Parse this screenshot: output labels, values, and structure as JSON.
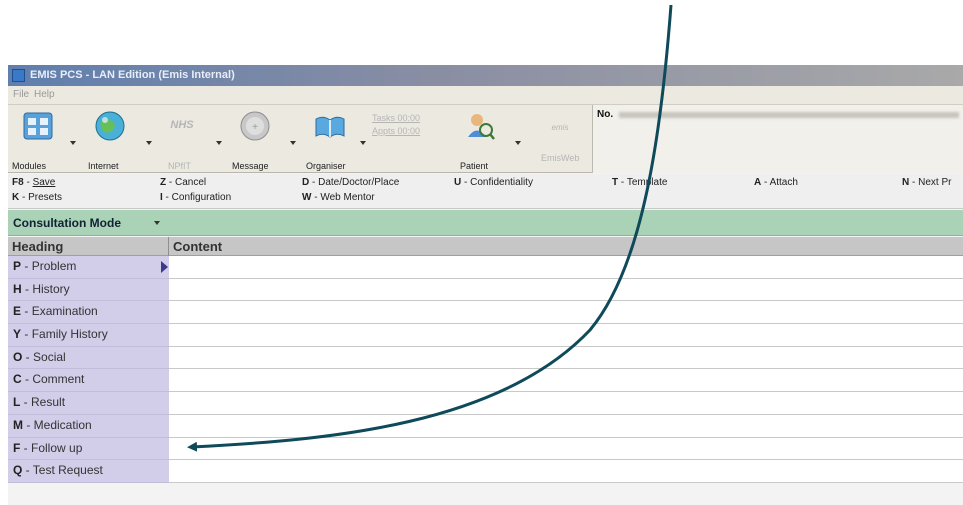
{
  "window": {
    "title": "EMIS PCS - LAN Edition (Emis Internal)"
  },
  "menu": [
    "File",
    "Help"
  ],
  "toolbar": {
    "modules": "Modules",
    "internet": "Internet",
    "nhs_logo": "NHS",
    "nhs_label": "NPfIT",
    "message": "Message",
    "tasks_text": "Tasks 00:00",
    "appts_text": "Appts 00:00",
    "organiser": "Organiser",
    "patient": "Patient",
    "emisweb_logo": "emis",
    "emisweb": "EmisWeb"
  },
  "patient_bar": {
    "no_label": "No."
  },
  "shortcuts": [
    {
      "key": "F8",
      "label": "Save"
    },
    {
      "key": "Z",
      "label": "Cancel"
    },
    {
      "key": "D",
      "label": "Date/Doctor/Place"
    },
    {
      "key": "U",
      "label": "Confidentiality"
    },
    {
      "key": "T",
      "label": "Template"
    },
    {
      "key": "A",
      "label": "Attach"
    },
    {
      "key": "N",
      "label": "Next Pr"
    },
    {
      "key": "K",
      "label": "Presets"
    },
    {
      "key": "I",
      "label": "Configuration"
    },
    {
      "key": "W",
      "label": "Web Mentor"
    }
  ],
  "mode": {
    "label": "Consultation Mode"
  },
  "grid": {
    "heading_col": "Heading",
    "content_col": "Content",
    "rows": [
      {
        "key": "P",
        "label": "Problem"
      },
      {
        "key": "H",
        "label": "History"
      },
      {
        "key": "E",
        "label": "Examination"
      },
      {
        "key": "Y",
        "label": "Family History"
      },
      {
        "key": "O",
        "label": "Social"
      },
      {
        "key": "C",
        "label": "Comment"
      },
      {
        "key": "L",
        "label": "Result"
      },
      {
        "key": "M",
        "label": "Medication"
      },
      {
        "key": "F",
        "label": "Follow up"
      },
      {
        "key": "Q",
        "label": "Test Request"
      }
    ]
  },
  "colors": {
    "annotation_arrow": "#0e4a5a",
    "mode_bar": "#a9d2b6",
    "heading_column": "#d2cde9"
  }
}
